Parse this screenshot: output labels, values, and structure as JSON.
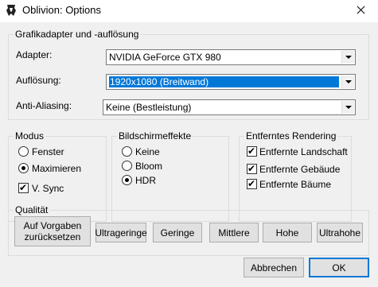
{
  "window": {
    "title": "Oblivion: Options",
    "icon": "oblivion-icon"
  },
  "graphics": {
    "legend": "Grafikadapter und -auflösung",
    "adapter_label": "Adapter:",
    "adapter_value": "NVIDIA GeForce GTX 980",
    "resolution_label": "Auflösung:",
    "resolution_value": "1920x1080 (Breitwand)",
    "aa_label": "Anti-Aliasing:",
    "aa_value": "Keine (Bestleistung)"
  },
  "mode": {
    "legend": "Modus",
    "windowed": "Fenster",
    "maximize": "Maximieren",
    "vsync": "V. Sync",
    "selected": "maximize",
    "vsync_checked": true
  },
  "effects": {
    "legend": "Bildschirmeffekte",
    "none": "Keine",
    "bloom": "Bloom",
    "hdr": "HDR",
    "selected": "hdr"
  },
  "distant": {
    "legend": "Entferntes Rendering",
    "landscape": "Entfernte Landschaft",
    "buildings": "Entfernte Gebäude",
    "trees": "Entfernte Bäume"
  },
  "quality": {
    "legend": "Qualität",
    "reset": "Auf Vorgaben zurücksetzen",
    "ultralow": "Ultrageringe",
    "low": "Geringe",
    "medium": "Mittlere",
    "high": "Hohe",
    "ultrahigh": "Ultrahohe"
  },
  "footer": {
    "cancel": "Abbrechen",
    "ok": "OK"
  },
  "colors": {
    "accent": "#0078d7",
    "dialog_bg": "#f0f0f0"
  }
}
